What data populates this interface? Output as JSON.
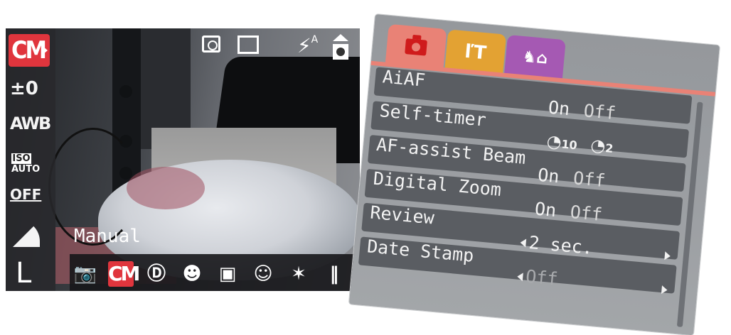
{
  "viewfinder": {
    "mode_badge": "CM",
    "exposure": "±0",
    "white_balance": "AWB",
    "iso_top": "ISO",
    "iso_bottom": "AUTO",
    "stabilizer": "OFF",
    "size": "L",
    "flash": "⚡",
    "flash_mode": "A",
    "mode_name": "Manual",
    "mode_strip": [
      {
        "icon": "camera-auto-icon",
        "glyph": "📷"
      },
      {
        "icon": "manual-mode-icon",
        "glyph": "CM"
      },
      {
        "icon": "digital-macro-icon",
        "glyph": "Ⓓ"
      },
      {
        "icon": "portrait-icon",
        "glyph": "☻"
      },
      {
        "icon": "landscape-icon",
        "glyph": "▣"
      },
      {
        "icon": "kids-pets-icon",
        "glyph": "☺"
      },
      {
        "icon": "party-icon",
        "glyph": "✶"
      },
      {
        "icon": "stitch-icon",
        "glyph": "‖"
      }
    ]
  },
  "menu": {
    "tabs": [
      {
        "name": "shooting",
        "icon": "camera-tab-icon",
        "color": "#e98276"
      },
      {
        "name": "setup",
        "icon": "tools-tab-icon",
        "color": "#e3a233"
      },
      {
        "name": "my-camera",
        "icon": "my-camera-tab-icon",
        "color": "#a559b3"
      }
    ],
    "items": [
      {
        "label": "AiAF",
        "opt1": "On",
        "opt2": "Off"
      },
      {
        "label": "Self-timer",
        "opt1": "10",
        "opt2": "2"
      },
      {
        "label": "AF-assist Beam",
        "opt1": "On",
        "opt2": "Off"
      },
      {
        "label": "Digital Zoom",
        "opt1": "On",
        "opt2": "Off"
      },
      {
        "label": "Review",
        "value": "2 sec."
      },
      {
        "label": "Date Stamp",
        "value": "Off"
      }
    ]
  }
}
